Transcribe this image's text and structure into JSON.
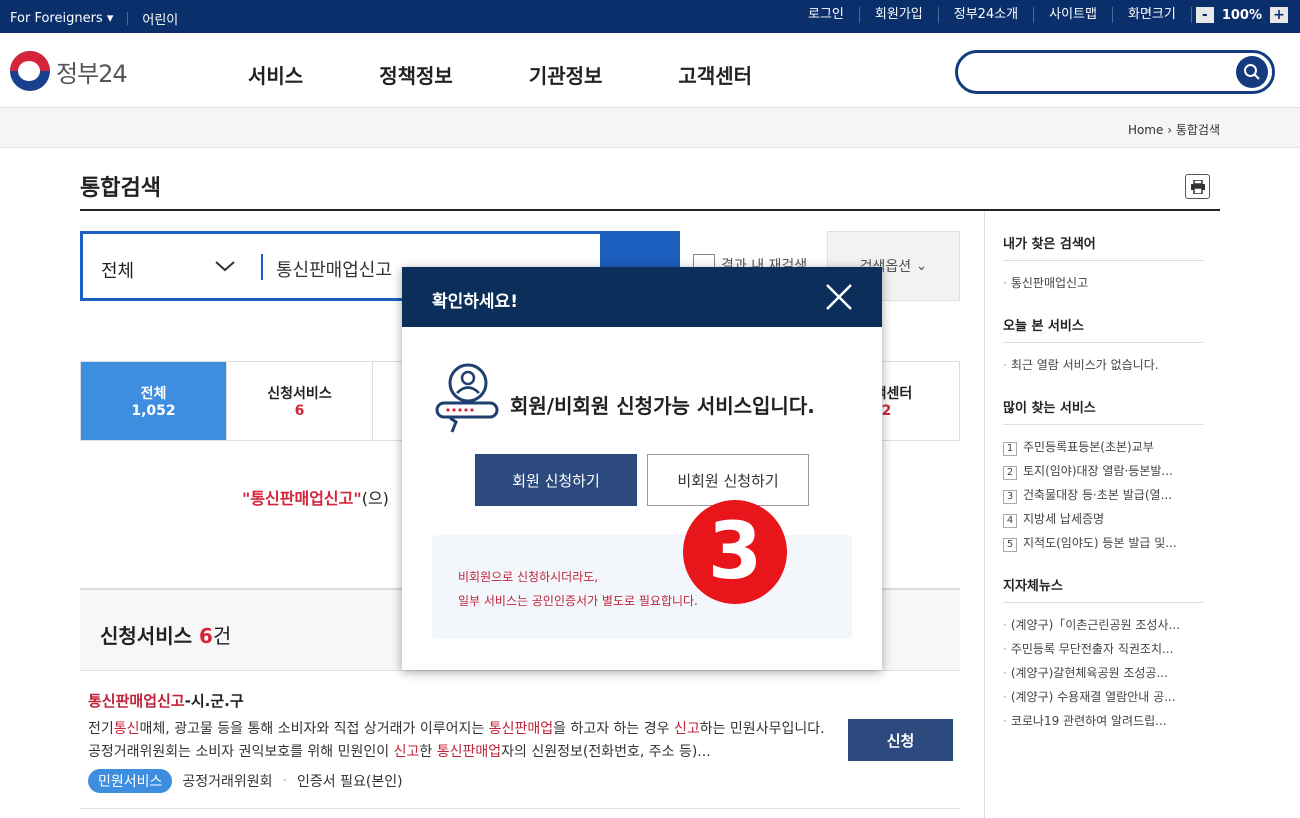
{
  "topbar": {
    "foreigners": "For Foreigners",
    "kids": "어린이",
    "links": [
      "로그인",
      "회원가입",
      "정부24소개",
      "사이트맵",
      "화면크기"
    ],
    "zoom_minus": "-",
    "zoom_value": "100%",
    "zoom_plus": "+"
  },
  "header": {
    "logo_text": "정부24",
    "nav": [
      "서비스",
      "정책정보",
      "기관정보",
      "고객센터"
    ]
  },
  "breadcrumb": {
    "home": "Home",
    "current": "통합검색"
  },
  "page": {
    "title": "통합검색"
  },
  "search": {
    "category": "전체",
    "query": "통신판매업신고",
    "recheck_label": "결과 내 재검색",
    "options_label": "검색옵션"
  },
  "tabs": [
    {
      "label": "전체",
      "count": "1,052"
    },
    {
      "label": "신청서비스",
      "count": "6"
    }
  ],
  "tab_last": {
    "label": "고객센터",
    "count": "2"
  },
  "result_msg": {
    "term": "\"통신판매업신고\"",
    "suffix": "(으)"
  },
  "section": {
    "title": "신청서비스",
    "count": "6",
    "unit": "건"
  },
  "item": {
    "title_hl": "통신판매업신고",
    "title_rest": "-시.군.구",
    "desc_1": "전기",
    "desc_2": "통신",
    "desc_3": "매체, 광고물 등을 통해 소비자와 직접 상거래가 이루어지는 ",
    "desc_4": "통신판매업",
    "desc_5": "을 하고자 하는 경우 ",
    "desc_6": "신고",
    "desc_7": "하는 민원사무입니다. 공정거래위원회는 소비자 권익보호를 위해 민원인이 ",
    "desc_8": "신고",
    "desc_9": "한 ",
    "desc_10": "통신판매업",
    "desc_11": "자의 신원정보(전화번호, 주소 등)...",
    "apply": "신청",
    "tag": "민원서비스",
    "org": "공정거래위원회",
    "cert": "인증서 필요(본인)"
  },
  "sidebar": {
    "recent_title": "내가 찾은 검색어",
    "recent_items": [
      "통신판매업신고"
    ],
    "today_title": "오늘 본 서비스",
    "today_items": [
      "최근 열람 서비스가 없습니다."
    ],
    "popular_title": "많이 찾는 서비스",
    "popular_items": [
      {
        "num": "1",
        "label": "주민등록표등본(초본)교부"
      },
      {
        "num": "2",
        "label": "토지(임야)대장 열람·등본발..."
      },
      {
        "num": "3",
        "label": "건축물대장 등·초본 발급(열..."
      },
      {
        "num": "4",
        "label": "지방세 납세증명"
      },
      {
        "num": "5",
        "label": "지적도(임야도) 등본 발급 및..."
      }
    ],
    "news_title": "지자체뉴스",
    "news_items": [
      "(계양구)「이촌근린공원 조성사...",
      "주민등록 무단전출자 직권조치...",
      "(계양구)갈현체육공원 조성공...",
      "(계양구) 수용재결 열람안내 공...",
      "코로나19 관련하여 알려드립..."
    ]
  },
  "modal": {
    "title": "확인하세요!",
    "message": "회원/비회원 신청가능 서비스입니다.",
    "member_btn": "회원 신청하기",
    "guest_btn": "비회원 신청하기",
    "note_1": "비회원으로 신청하시더라도,",
    "note_2": "일부 서비스는 공인인증서가 별도로 필요합니다."
  },
  "annotation": {
    "badge": "3"
  },
  "colors": {
    "navy": "#0b2f6b",
    "blue": "#1d5fc0",
    "red": "#d6253b"
  }
}
